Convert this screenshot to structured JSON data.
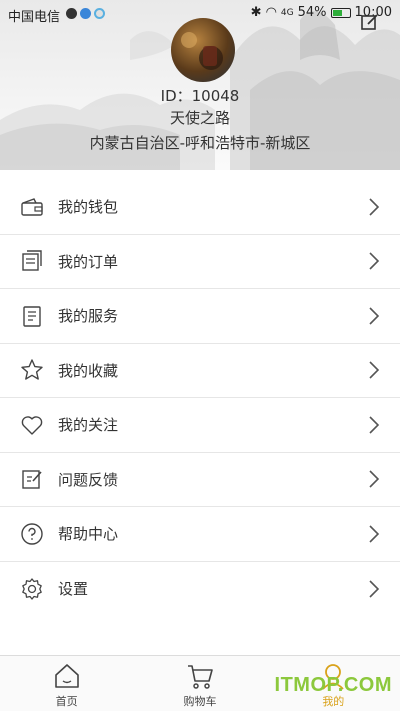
{
  "status_bar": {
    "carrier": "中国电信",
    "network": "4G",
    "battery_percent": "54%",
    "battery_level": 0.54,
    "time": "10:00"
  },
  "profile": {
    "id_text": "ID：10048",
    "name": "天使之路",
    "region": "内蒙古自治区-呼和浩特市-新城区"
  },
  "menu": {
    "items": [
      {
        "label": "我的钱包",
        "icon": "wallet-icon"
      },
      {
        "label": "我的订单",
        "icon": "orders-icon"
      },
      {
        "label": "我的服务",
        "icon": "service-icon"
      },
      {
        "label": "我的收藏",
        "icon": "star-icon"
      },
      {
        "label": "我的关注",
        "icon": "heart-icon"
      },
      {
        "label": "问题反馈",
        "icon": "feedback-icon"
      },
      {
        "label": "帮助中心",
        "icon": "help-icon"
      },
      {
        "label": "设置",
        "icon": "gear-icon"
      }
    ]
  },
  "tabbar": {
    "tabs": [
      {
        "label": "首页",
        "icon": "home-icon",
        "active": false
      },
      {
        "label": "购物车",
        "icon": "cart-icon",
        "active": false
      },
      {
        "label": "我的",
        "icon": "profile-icon",
        "active": true
      }
    ]
  },
  "watermark": "ITMOP.COM",
  "colors": {
    "active_tab": "#d9a21a",
    "divider": "#e6e6e6",
    "battery": "#2eae3a",
    "watermark": "#8cc83c"
  }
}
